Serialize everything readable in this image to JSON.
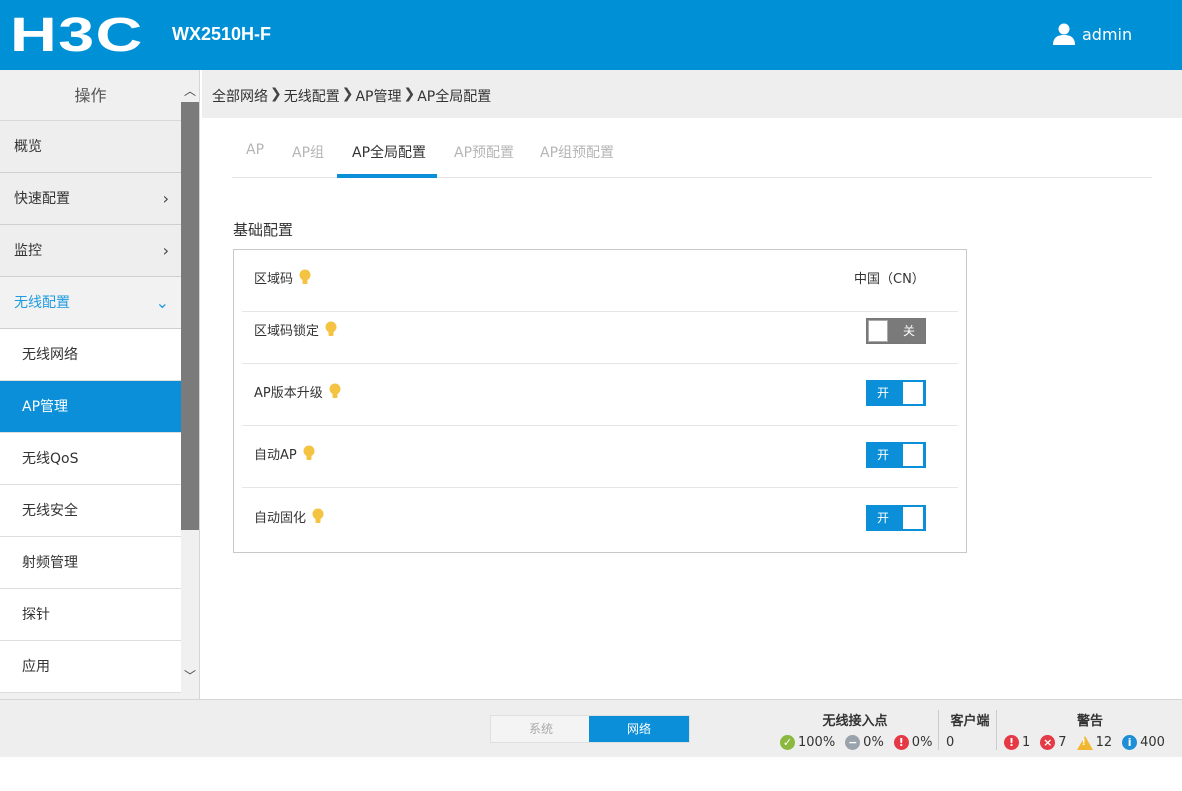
{
  "header": {
    "logo_text": "H3C",
    "model": "WX2510H-F",
    "user": "admin",
    "bg_color": "#0090d6"
  },
  "sidebar": {
    "title": "操作",
    "items": [
      {
        "label": "概览",
        "chevron": ""
      },
      {
        "label": "快速配置",
        "chevron": "›"
      },
      {
        "label": "监控",
        "chevron": "›"
      },
      {
        "label": "无线配置",
        "chevron": "⌄"
      }
    ],
    "subitems": [
      {
        "label": "无线网络"
      },
      {
        "label": "AP管理"
      },
      {
        "label": "无线QoS"
      },
      {
        "label": "无线安全"
      },
      {
        "label": "射频管理"
      },
      {
        "label": "探针"
      },
      {
        "label": "应用"
      }
    ],
    "scroll_up": "︿",
    "scroll_down": "﹀"
  },
  "breadcrumb": {
    "parts": [
      "全部网络",
      "无线配置",
      "AP管理",
      "AP全局配置"
    ],
    "sep": "❯"
  },
  "tabs": [
    "AP",
    "AP组",
    "AP全局配置",
    "AP预配置",
    "AP组预配置"
  ],
  "section": {
    "title": "基础配置",
    "rows": [
      {
        "label": "区域码",
        "value": "中国（CN）"
      },
      {
        "label": "区域码锁定",
        "toggle": "关",
        "state": "off"
      },
      {
        "label": "AP版本升级",
        "toggle": "开",
        "state": "on"
      },
      {
        "label": "自动AP",
        "toggle": "开",
        "state": "on"
      },
      {
        "label": "自动固化",
        "toggle": "开",
        "state": "on"
      }
    ]
  },
  "footer": {
    "switch_off": "系统",
    "switch_on": "网络",
    "ap": {
      "title": "无线接入点",
      "online": "100%",
      "disabled": "0%",
      "error": "0%"
    },
    "clients": {
      "title": "客户端",
      "count": "0"
    },
    "alerts": {
      "title": "警告",
      "critical": "1",
      "error": "7",
      "warning": "12",
      "info": "400"
    }
  }
}
